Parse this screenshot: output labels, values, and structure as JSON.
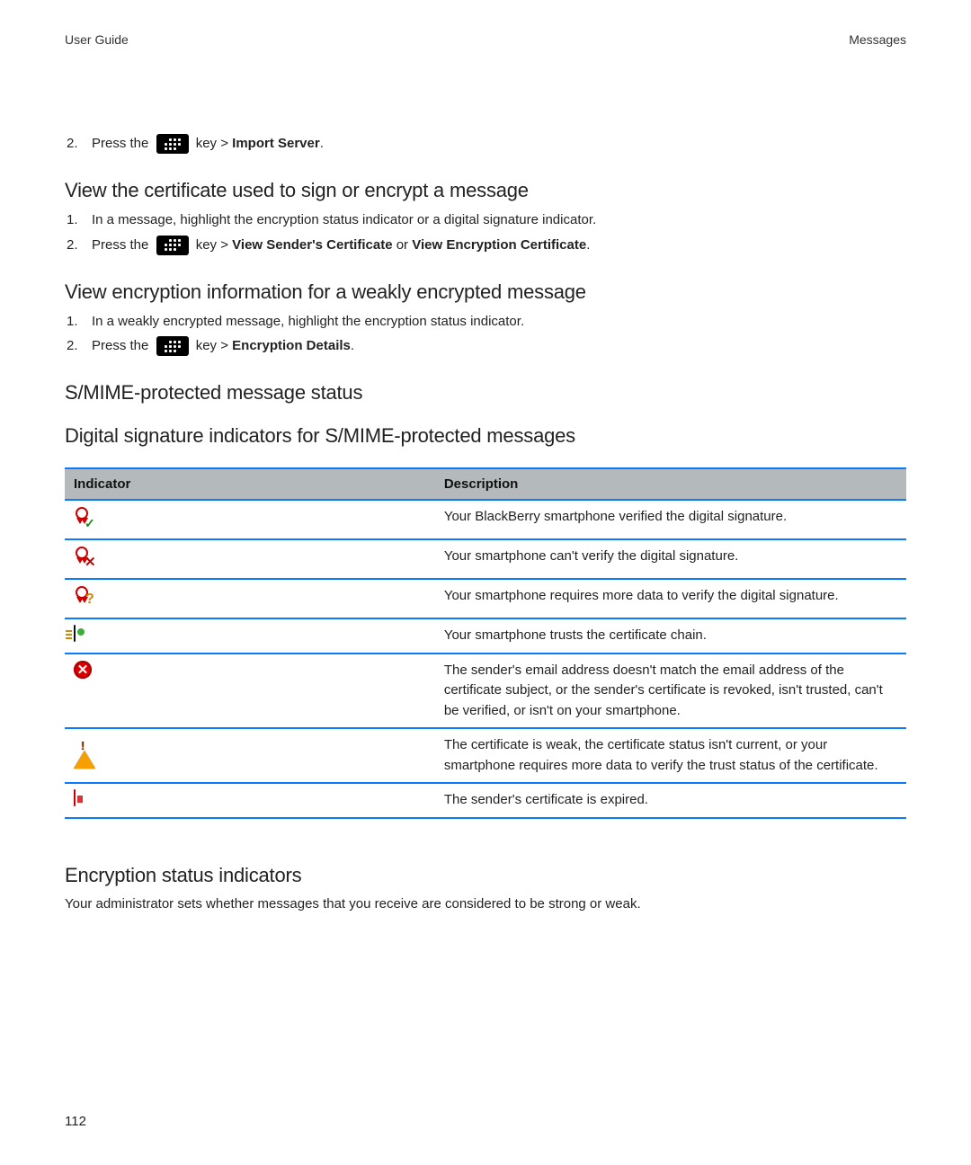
{
  "header": {
    "left": "User Guide",
    "right": "Messages"
  },
  "startStep": {
    "num": "2.",
    "prefix": "Press the",
    "key_label": "key >",
    "bold": "Import Server",
    "suffix": "."
  },
  "section1": {
    "title": "View the certificate used to sign or encrypt a message",
    "steps": [
      {
        "num": "1.",
        "text": "In a message, highlight the encryption status indicator or a digital signature indicator."
      },
      {
        "num": "2.",
        "prefix": "Press the",
        "key_label": "key >",
        "bold1": "View Sender's Certificate",
        "mid": " or ",
        "bold2": "View Encryption Certificate",
        "suffix": "."
      }
    ]
  },
  "section2": {
    "title": "View encryption information for a weakly encrypted message",
    "steps": [
      {
        "num": "1.",
        "text": "In a weakly encrypted message, highlight the encryption status indicator."
      },
      {
        "num": "2.",
        "prefix": "Press the",
        "key_label": "key >",
        "bold": "Encryption Details",
        "suffix": "."
      }
    ]
  },
  "section3_title": "S/MIME-protected message status",
  "section4_title": "Digital signature indicators for S/MIME-protected messages",
  "table": {
    "col1": "Indicator",
    "col2": "Description",
    "rows": [
      {
        "icon": "ribbon-check",
        "desc": "Your BlackBerry smartphone verified the digital signature."
      },
      {
        "icon": "ribbon-x",
        "desc": "Your smartphone can't verify the digital signature."
      },
      {
        "icon": "ribbon-q",
        "desc": "Your smartphone requires more data to verify the digital signature."
      },
      {
        "icon": "cert-chain",
        "desc": "Your smartphone trusts the certificate chain."
      },
      {
        "icon": "red-x",
        "desc": "The sender's email address doesn't match the email address of the certificate subject, or the sender's certificate is revoked, isn't trusted, can't be verified, or isn't on your smartphone."
      },
      {
        "icon": "warning",
        "desc": "The certificate is weak, the certificate status isn't current, or your smartphone requires more data to verify the trust status of the certificate."
      },
      {
        "icon": "expired",
        "desc": "The sender's certificate is expired."
      }
    ]
  },
  "section5": {
    "title": "Encryption status indicators",
    "body": "Your administrator sets whether messages that you receive are considered to be strong or weak."
  },
  "page_number": "112"
}
